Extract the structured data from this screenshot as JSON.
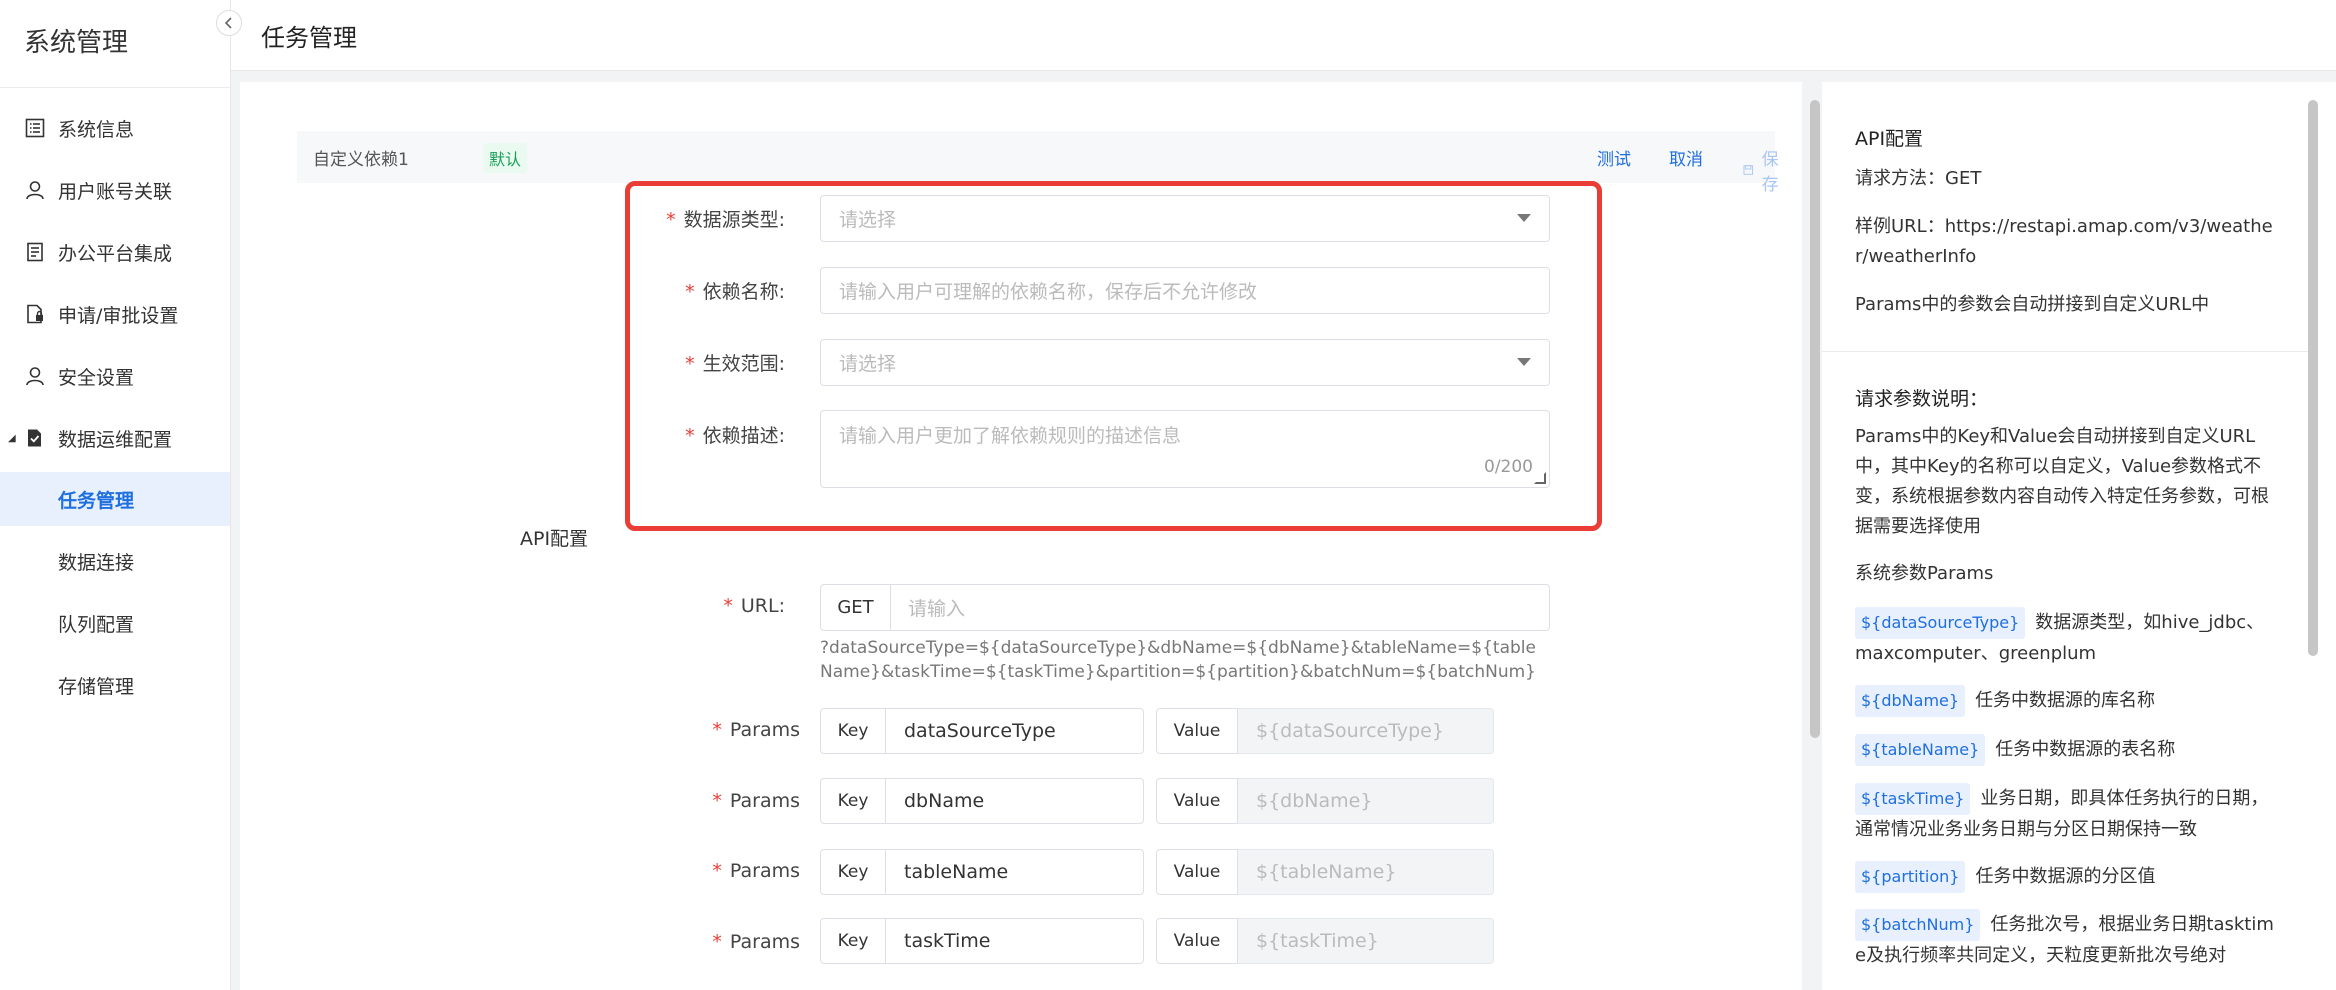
{
  "sidebar": {
    "title": "系统管理",
    "items": [
      {
        "label": "系统信息",
        "icon": "list-icon"
      },
      {
        "label": "用户账号关联",
        "icon": "user-icon"
      },
      {
        "label": "办公平台集成",
        "icon": "document-icon"
      },
      {
        "label": "申请/审批设置",
        "icon": "file-lock-icon"
      },
      {
        "label": "安全设置",
        "icon": "user-icon"
      },
      {
        "label": "数据运维配置",
        "icon": "file-check-icon"
      },
      {
        "label": "任务管理",
        "active": true
      },
      {
        "label": "数据连接"
      },
      {
        "label": "队列配置"
      },
      {
        "label": "存储管理"
      }
    ]
  },
  "header": {
    "title": "任务管理"
  },
  "dependency": {
    "name": "自定义依赖1",
    "tag": "默认",
    "test": "测试",
    "cancel": "取消",
    "save": "保存"
  },
  "form": {
    "source_type": {
      "label": "数据源类型:",
      "placeholder": "请选择"
    },
    "dep_name": {
      "label": "依赖名称:",
      "placeholder": "请输入用户可理解的依赖名称，保存后不允许修改"
    },
    "scope": {
      "label": "生效范围:",
      "placeholder": "请选择"
    },
    "dep_desc": {
      "label": "依赖描述:",
      "placeholder": "请输入用户更加了解依赖规则的描述信息",
      "counter": "0/200"
    },
    "api_section": "API配置",
    "url": {
      "label": "URL:",
      "method": "GET",
      "placeholder": "请输入",
      "hint": "?dataSourceType=${dataSourceType}&dbName=${dbName}&tableName=${tableName}&taskTime=${taskTime}&partition=${partition}&batchNum=${batchNum}"
    },
    "params_label": "Params",
    "key_label": "Key",
    "value_label": "Value",
    "params": [
      {
        "key": "dataSourceType",
        "value": "${dataSourceType}"
      },
      {
        "key": "dbName",
        "value": "${dbName}"
      },
      {
        "key": "tableName",
        "value": "${tableName}"
      },
      {
        "key": "taskTime",
        "value": "${taskTime}"
      }
    ]
  },
  "right_panel": {
    "api_title": "API配置",
    "method_line": "请求方法：GET",
    "sample_url": "样例URL：https://restapi.amap.com/v3/weather/weatherInfo",
    "auto_append": "Params中的参数会自动拼接到自定义URL中",
    "param_title": "请求参数说明：",
    "param_desc": "Params中的Key和Value会自动拼接到自定义URL中，其中Key的名称可以自定义，Value参数格式不变，系统根据参数内容自动传入特定任务参数，可根据需要选择使用",
    "sys_params_title": "系统参数Params",
    "sys_params": [
      {
        "tag": "${dataSourceType}",
        "desc": "数据源类型，如hive_jdbc、maxcomputer、greenplum"
      },
      {
        "tag": "${dbName}",
        "desc": "任务中数据源的库名称"
      },
      {
        "tag": "${tableName}",
        "desc": "任务中数据源的表名称"
      },
      {
        "tag": "${taskTime}",
        "desc": "业务日期，即具体任务执行的日期，通常情况业务业务日期与分区日期保持一致"
      },
      {
        "tag": "${partition}",
        "desc": "任务中数据源的分区值"
      },
      {
        "tag": "${batchNum}",
        "desc": "任务批次号，根据业务日期tasktime及执行频率共同定义，天粒度更新批次号绝对"
      }
    ]
  },
  "colors": {
    "accent": "#1f6fe0",
    "highlight_border": "#ea3d35",
    "required": "#ea3d35",
    "tag_green": "#18a058"
  }
}
